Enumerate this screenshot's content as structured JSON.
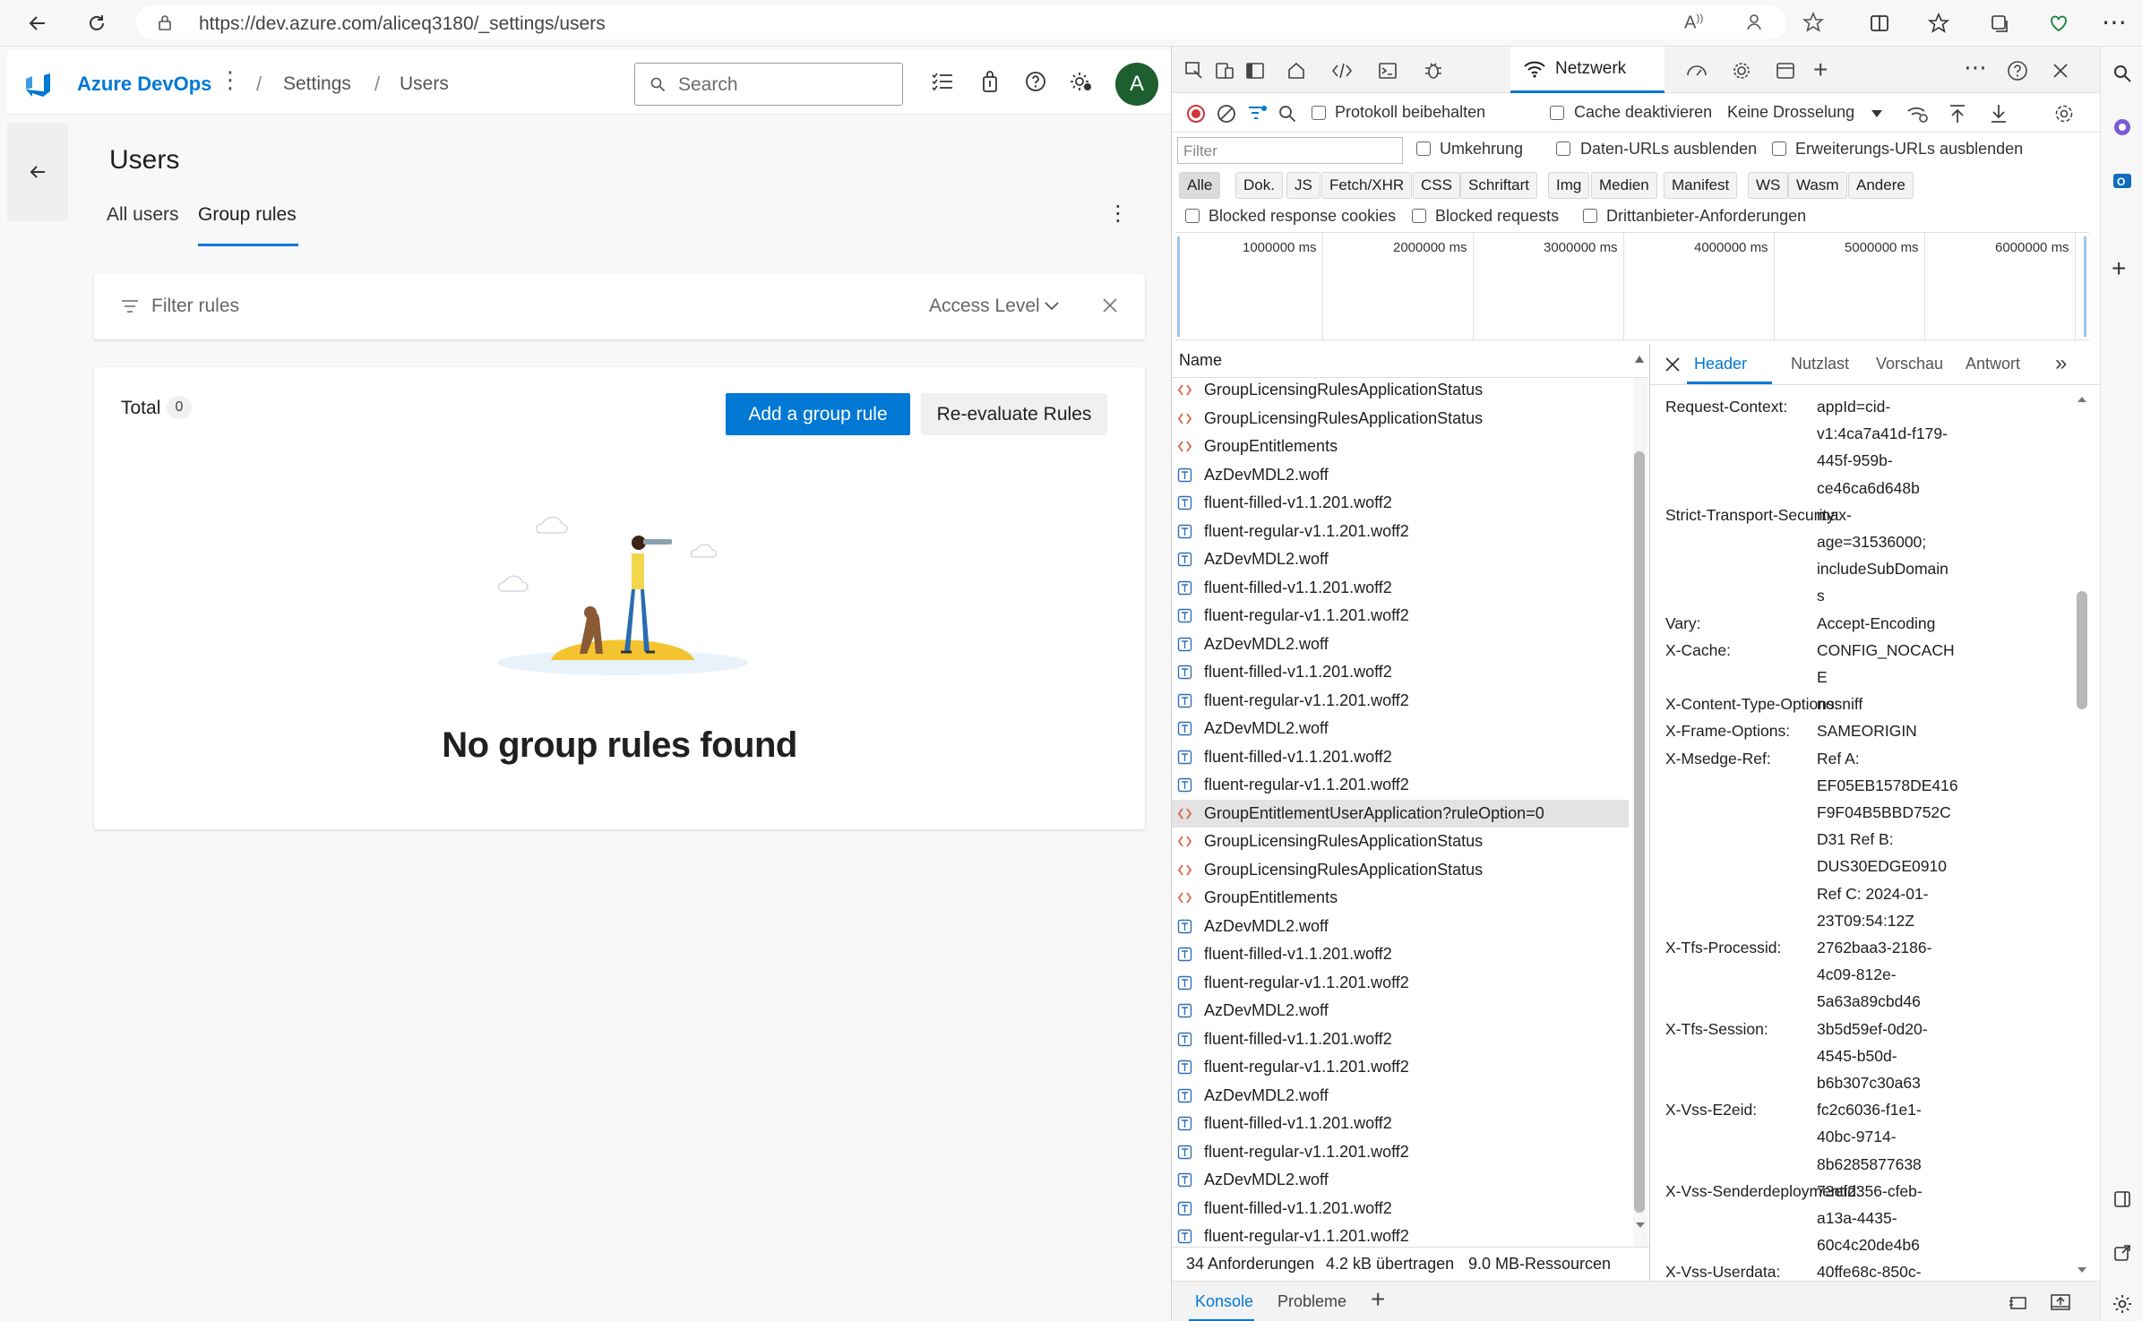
{
  "browser": {
    "url": "https://dev.azure.com/aliceq3180/_settings/users"
  },
  "ado": {
    "brand": "Azure DevOps",
    "breadcrumbs": [
      "Settings",
      "Users"
    ],
    "search_placeholder": "Search",
    "avatar_initial": "A",
    "page_title": "Users",
    "tabs": [
      "All users",
      "Group rules"
    ],
    "active_tab": "Group rules",
    "filter_placeholder": "Filter rules",
    "access_level_label": "Access Level",
    "total_label": "Total",
    "total_count": "0",
    "add_rule_label": "Add a group rule",
    "reevaluate_label": "Re-evaluate Rules",
    "empty_message": "No group rules found",
    "accent_color": "#0078d4"
  },
  "devtools": {
    "active_tool": "Netzwerk",
    "options": {
      "preserve_log": "Protokoll beibehalten",
      "disable_cache": "Cache deaktivieren",
      "throttling": "Keine Drosselung"
    },
    "filter_placeholder": "Filter",
    "filter_checks": [
      "Umkehrung",
      "Daten-URLs ausblenden",
      "Erweiterungs-URLs ausblenden"
    ],
    "types": [
      "Alle",
      "Dok.",
      "JS",
      "Fetch/XHR",
      "CSS",
      "Schriftart",
      "Img",
      "Medien",
      "Manifest",
      "WS",
      "Wasm",
      "Andere"
    ],
    "active_type": "Alle",
    "block_checks": [
      "Blocked response cookies",
      "Blocked requests",
      "Drittanbieter-Anforderungen"
    ],
    "timeline_ticks": [
      "1000000 ms",
      "2000000 ms",
      "3000000 ms",
      "4000000 ms",
      "5000000 ms",
      "6000000 ms"
    ],
    "name_column": "Name",
    "requests": [
      {
        "name": "GroupLicensingRulesApplicationStatus",
        "kind": "xhr"
      },
      {
        "name": "GroupLicensingRulesApplicationStatus",
        "kind": "xhr"
      },
      {
        "name": "GroupEntitlements",
        "kind": "xhr"
      },
      {
        "name": "AzDevMDL2.woff",
        "kind": "font"
      },
      {
        "name": "fluent-filled-v1.1.201.woff2",
        "kind": "font"
      },
      {
        "name": "fluent-regular-v1.1.201.woff2",
        "kind": "font"
      },
      {
        "name": "AzDevMDL2.woff",
        "kind": "font"
      },
      {
        "name": "fluent-filled-v1.1.201.woff2",
        "kind": "font"
      },
      {
        "name": "fluent-regular-v1.1.201.woff2",
        "kind": "font"
      },
      {
        "name": "AzDevMDL2.woff",
        "kind": "font"
      },
      {
        "name": "fluent-filled-v1.1.201.woff2",
        "kind": "font"
      },
      {
        "name": "fluent-regular-v1.1.201.woff2",
        "kind": "font"
      },
      {
        "name": "AzDevMDL2.woff",
        "kind": "font"
      },
      {
        "name": "fluent-filled-v1.1.201.woff2",
        "kind": "font"
      },
      {
        "name": "fluent-regular-v1.1.201.woff2",
        "kind": "font"
      },
      {
        "name": "GroupEntitlementUserApplication?ruleOption=0",
        "kind": "xhr",
        "selected": true
      },
      {
        "name": "GroupLicensingRulesApplicationStatus",
        "kind": "xhr"
      },
      {
        "name": "GroupLicensingRulesApplicationStatus",
        "kind": "xhr"
      },
      {
        "name": "GroupEntitlements",
        "kind": "xhr"
      },
      {
        "name": "AzDevMDL2.woff",
        "kind": "font"
      },
      {
        "name": "fluent-filled-v1.1.201.woff2",
        "kind": "font"
      },
      {
        "name": "fluent-regular-v1.1.201.woff2",
        "kind": "font"
      },
      {
        "name": "AzDevMDL2.woff",
        "kind": "font"
      },
      {
        "name": "fluent-filled-v1.1.201.woff2",
        "kind": "font"
      },
      {
        "name": "fluent-regular-v1.1.201.woff2",
        "kind": "font"
      },
      {
        "name": "AzDevMDL2.woff",
        "kind": "font"
      },
      {
        "name": "fluent-filled-v1.1.201.woff2",
        "kind": "font"
      },
      {
        "name": "fluent-regular-v1.1.201.woff2",
        "kind": "font"
      },
      {
        "name": "AzDevMDL2.woff",
        "kind": "font"
      },
      {
        "name": "fluent-filled-v1.1.201.woff2",
        "kind": "font"
      },
      {
        "name": "fluent-regular-v1.1.201.woff2",
        "kind": "font"
      }
    ],
    "status": {
      "requests": "34 Anforderungen",
      "transferred": "4.2 kB übertragen",
      "resources": "9.0 MB-Ressourcen"
    },
    "detail_tabs": [
      "Header",
      "Nutzlast",
      "Vorschau",
      "Antwort"
    ],
    "active_detail_tab": "Header",
    "headers": [
      {
        "key": "Request-Context:",
        "lines": [
          "appId=cid-",
          "v1:4ca7a41d-f179-",
          "445f-959b-",
          "ce46ca6d648b"
        ]
      },
      {
        "key": "Strict-Transport-Security:",
        "lines": [
          "max-",
          "age=31536000;",
          "includeSubDomain",
          "s"
        ]
      },
      {
        "key": "Vary:",
        "lines": [
          "Accept-Encoding"
        ]
      },
      {
        "key": "X-Cache:",
        "lines": [
          "CONFIG_NOCACH",
          "E"
        ]
      },
      {
        "key": "X-Content-Type-Options:",
        "lines": [
          "nosniff"
        ]
      },
      {
        "key": "X-Frame-Options:",
        "lines": [
          "SAMEORIGIN"
        ]
      },
      {
        "key": "X-Msedge-Ref:",
        "lines": [
          "Ref A:",
          "EF05EB1578DE416",
          "F9F04B5BBD752C",
          "D31 Ref B:",
          "DUS30EDGE0910",
          "Ref C: 2024-01-",
          "23T09:54:12Z"
        ]
      },
      {
        "key": "X-Tfs-Processid:",
        "lines": [
          "2762baa3-2186-",
          "4c09-812e-",
          "5a63a89cbd46"
        ]
      },
      {
        "key": "X-Tfs-Session:",
        "lines": [
          "3b5d59ef-0d20-",
          "4545-b50d-",
          "b6b307c30a63"
        ]
      },
      {
        "key": "X-Vss-E2eid:",
        "lines": [
          "fc2c6036-f1e1-",
          "40bc-9714-",
          "8b6285877638"
        ]
      },
      {
        "key": "X-Vss-Senderdeploymentid:",
        "lines": [
          "73ef2356-cfeb-",
          "a13a-4435-",
          "60c4c20de4b6"
        ]
      },
      {
        "key": "X-Vss-Userdata:",
        "lines": [
          "40ffe68c-850c-"
        ]
      }
    ],
    "drawer_tabs": [
      "Konsole",
      "Probleme"
    ],
    "active_drawer_tab": "Konsole"
  }
}
